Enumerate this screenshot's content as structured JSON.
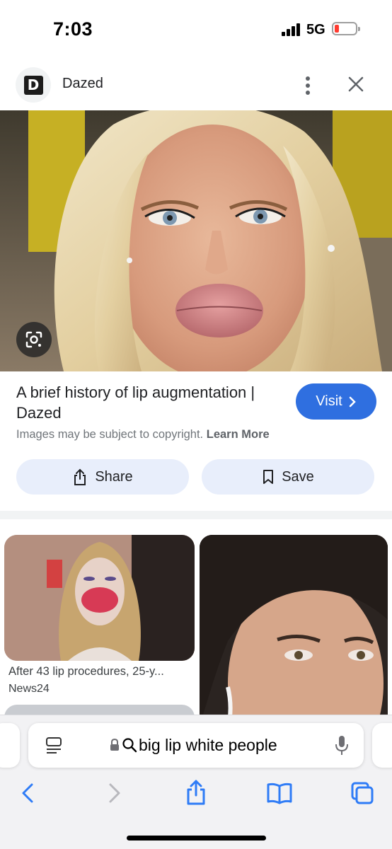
{
  "status_bar": {
    "time": "7:03",
    "network": "5G",
    "battery_level": 0.1
  },
  "source": {
    "logo_letter": "D",
    "name": "Dazed"
  },
  "result": {
    "title": "A brief history of lip augmentation | Dazed",
    "visit_label": "Visit",
    "copyright_text": "Images may be subject to copyright.",
    "learn_more": "Learn More",
    "share_label": "Share",
    "save_label": "Save"
  },
  "related": [
    {
      "caption": "After 43 lip procedures, 25-y...",
      "source": "News24"
    }
  ],
  "address_bar": {
    "query": "big lip white people"
  },
  "colors": {
    "accent": "#2f6fe0",
    "action_bg": "#e8eefb",
    "toolbar_icon": "#2f7cf6"
  },
  "icons": [
    "more-vertical-icon",
    "close-icon",
    "lens-icon",
    "share-icon",
    "bookmark-icon",
    "reader-icon",
    "lock-icon",
    "search-icon",
    "mic-icon",
    "back-icon",
    "forward-icon",
    "share-icon",
    "bookmarks-icon",
    "tabs-icon"
  ]
}
